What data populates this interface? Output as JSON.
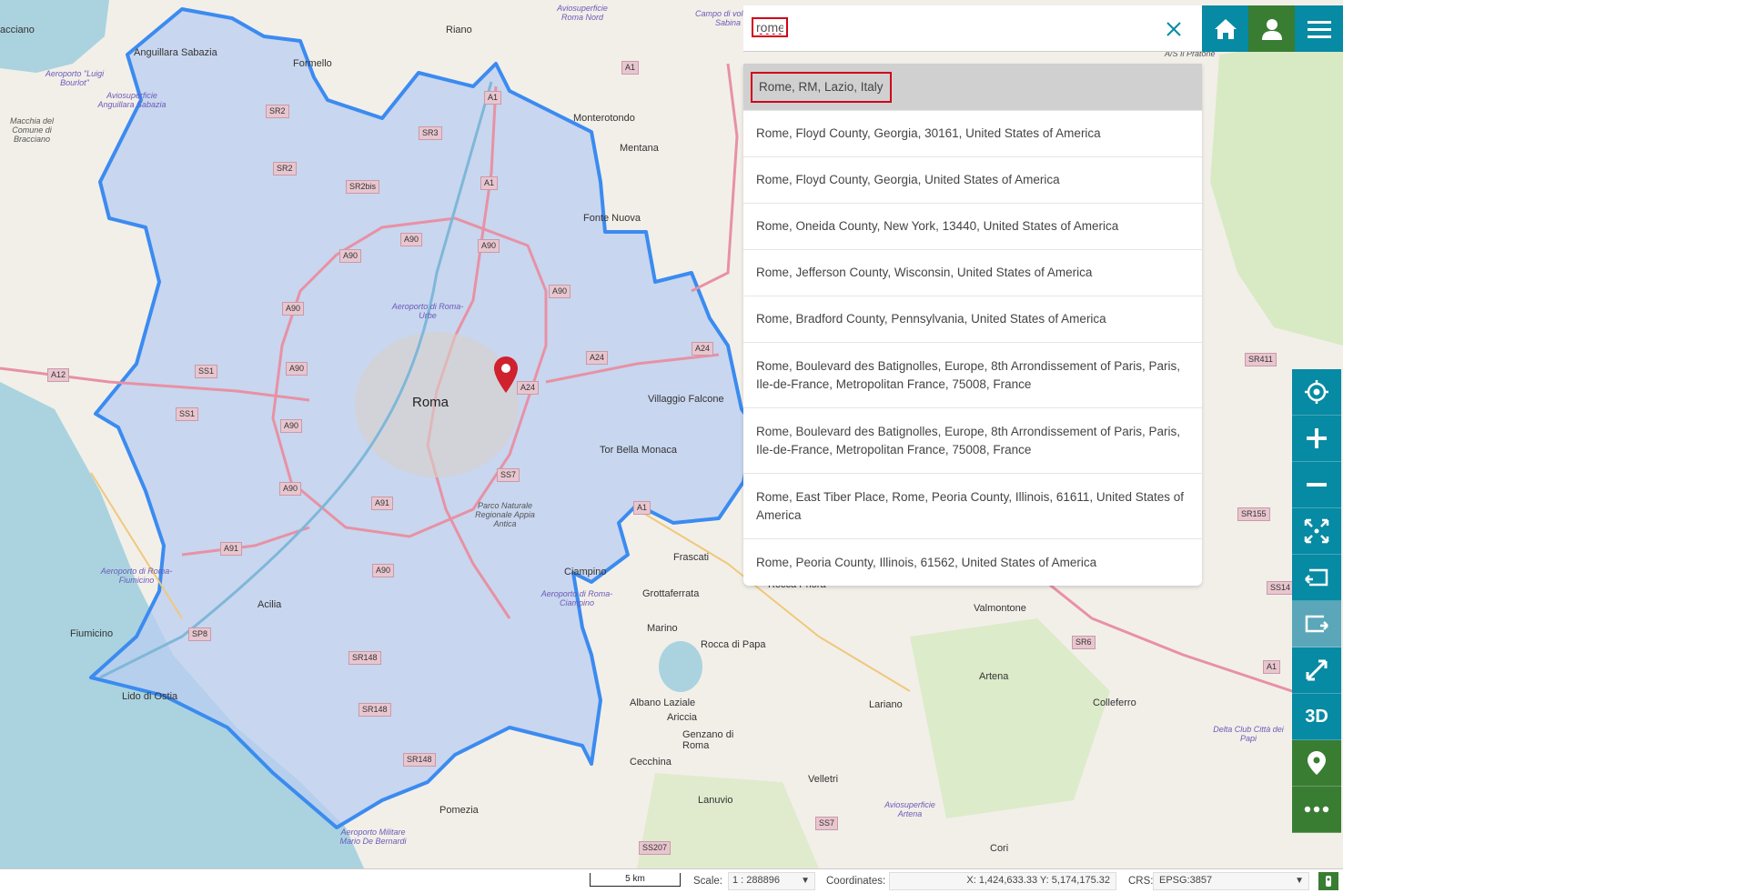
{
  "search": {
    "value": "rome",
    "clear_icon": "close-icon"
  },
  "header_buttons": {
    "home_icon": "home-icon",
    "user_icon": "user-icon",
    "menu_icon": "hamburger-menu-icon"
  },
  "results": [
    "Rome, RM, Lazio, Italy",
    "Rome, Floyd County, Georgia, 30161, United States of America",
    "Rome, Floyd County, Georgia, United States of America",
    "Rome, Oneida County, New York, 13440, United States of America",
    "Rome, Jefferson County, Wisconsin, United States of America",
    "Rome, Bradford County, Pennsylvania, United States of America",
    "Rome, Boulevard des Batignolles, Europe, 8th Arrondissement of Paris, Paris, Ile-de-France, Metropolitan France, 75008, France",
    "Rome, Boulevard des Batignolles, Europe, 8th Arrondissement of Paris, Paris, Ile-de-France, Metropolitan France, 75008, France",
    "Rome, East Tiber Place, Rome, Peoria County, Illinois, 61611, United States of America",
    "Rome, Peoria County, Illinois, 61562, United States of America"
  ],
  "toolbar": {
    "items": [
      {
        "icon": "locate-icon"
      },
      {
        "icon": "zoom-in-icon"
      },
      {
        "icon": "zoom-out-icon"
      },
      {
        "icon": "zoom-to-extent-icon"
      },
      {
        "icon": "previous-view-icon"
      },
      {
        "icon": "next-view-icon"
      },
      {
        "icon": "fullscreen-icon"
      },
      {
        "label": "3D"
      },
      {
        "icon": "map-marker-icon"
      },
      {
        "icon": "more-icon"
      }
    ]
  },
  "map_labels": {
    "roma": "Roma",
    "places": [
      "Anguillara Sabazia",
      "Formello",
      "Riano",
      "Monterotondo",
      "Mentana",
      "Fonte Nuova",
      "Villaggio Falcone",
      "Tor Bella Monaca",
      "Frascati",
      "Ciampino",
      "Grottaferrata",
      "Marino",
      "Rocca di Papa",
      "Albano Laziale",
      "Ariccia",
      "Genzano di Roma",
      "Cecchina",
      "Velletri",
      "Lanuvio",
      "Pomezia",
      "Acilia",
      "Fiumicino",
      "Lido di Ostia",
      "Valmontone",
      "Artena",
      "Lariano",
      "Colleferro",
      "Cori",
      "Rocca Priora",
      "Parco Naturale Regionale Appia Antica",
      "Macchia del Comune di Bracciano",
      "acciano"
    ],
    "airports": [
      "Aeroporto \"Luigi Bourlot\"",
      "Aviosuperficie Anguillara Sabazia",
      "Aeroporto di Roma-Urbe",
      "Aeroporto di Roma-Fiumicino",
      "Aeroporto di Roma-Ciampino",
      "Aeroporto Militare Mario De Bernardi",
      "Aviosuperficie Artena",
      "Delta Club Città dei Papi",
      "Aviosuperficie Roma Nord",
      "Campo di volo Fly Sabina",
      "A/S Il Pratone"
    ],
    "roads": [
      "A1",
      "A1",
      "A1",
      "A1",
      "A1",
      "A12",
      "A24",
      "A24",
      "A24",
      "A90",
      "A90",
      "A90",
      "A90",
      "A90",
      "A90",
      "A90",
      "A90",
      "A90",
      "A91",
      "A91",
      "SS1",
      "SS1",
      "SS7",
      "SP8",
      "SR2",
      "SR2bis",
      "SR3",
      "SR148",
      "SR148",
      "SR148",
      "SR411",
      "SR155",
      "SS207",
      "SS7",
      "SR6",
      "SS14",
      "SR2"
    ]
  },
  "footer": {
    "scalebar_label": "5 km",
    "scale_label": "Scale:",
    "scale_value": "1 : 288896",
    "coordinates_label": "Coordinates:",
    "coordinates_value": "X: 1,424,633.33 Y: 5,174,175.32",
    "crs_label": "CRS:",
    "crs_value": "EPSG:3857"
  },
  "colors": {
    "teal": "#078aa3",
    "green": "#397d32",
    "boundary": "#3b8bf0",
    "highlight": "#d0021b"
  }
}
